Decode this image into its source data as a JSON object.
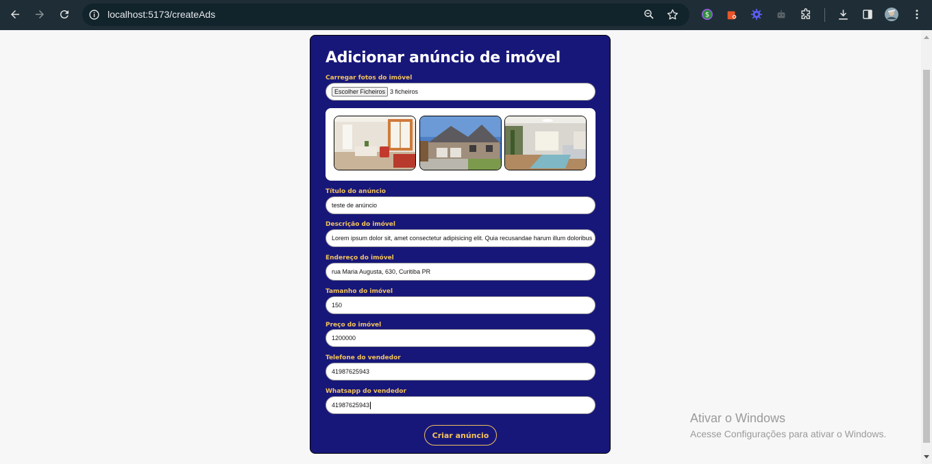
{
  "browser": {
    "url": "localhost:5173/createAds"
  },
  "form": {
    "title": "Adicionar anúncio de imóvel",
    "photos_label": "Carregar fotos do imóvel",
    "file_button": "Escolher Ficheiros",
    "file_status": "3 ficheiros",
    "fields": [
      {
        "label": "Título do anúncio",
        "value": "teste de anúncio"
      },
      {
        "label": "Descrição do imóvel",
        "value": "Lorem ipsum dolor sit, amet consectetur adipisicing elit. Quia recusandae harum illum doloribus"
      },
      {
        "label": "Endereço do imóvel",
        "value": "rua Maria Augusta, 630, Curitiba PR"
      },
      {
        "label": "Tamanho do imóvel",
        "value": "150"
      },
      {
        "label": "Preço do imóvel",
        "value": "1200000"
      },
      {
        "label": "Telefone do vendedor",
        "value": "41987625943"
      },
      {
        "label": "Whatsapp do vendedor",
        "value": "41987625943"
      }
    ],
    "submit_label": "Criar anúncio"
  },
  "watermark": {
    "title": "Ativar o Windows",
    "subtitle": "Acesse Configurações para ativar o Windows."
  },
  "colors": {
    "card_bg": "#17177a",
    "label": "#f3c35c",
    "chrome": "#1f2e36"
  }
}
